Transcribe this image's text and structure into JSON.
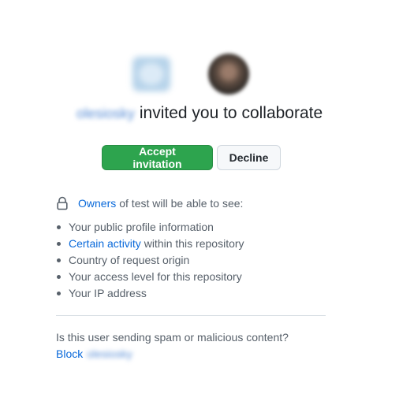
{
  "inviter": {
    "username": "olesiosky",
    "avatar_icon": "identicon-avatar"
  },
  "user": {
    "avatar_icon": "user-photo-avatar"
  },
  "heading": {
    "text": "invited you to collaborate"
  },
  "actions": {
    "accept_label": "Accept invitation",
    "decline_label": "Decline"
  },
  "permissions": {
    "owners_link": "Owners",
    "owners_suffix": "of test will be able to see:",
    "lock_icon": "lock-icon",
    "items": [
      {
        "link": "",
        "text": "Your public profile information"
      },
      {
        "link": "Certain activity",
        "text": "within this repository"
      },
      {
        "link": "",
        "text": "Country of request origin"
      },
      {
        "link": "",
        "text": "Your access level for this repository"
      },
      {
        "link": "",
        "text": "Your IP address"
      }
    ]
  },
  "report": {
    "question": "Is this user sending spam or malicious content?",
    "block_label": "Block",
    "block_username": "olesiosky"
  },
  "colors": {
    "accept_button": "#2da44e",
    "link": "#0969da"
  }
}
